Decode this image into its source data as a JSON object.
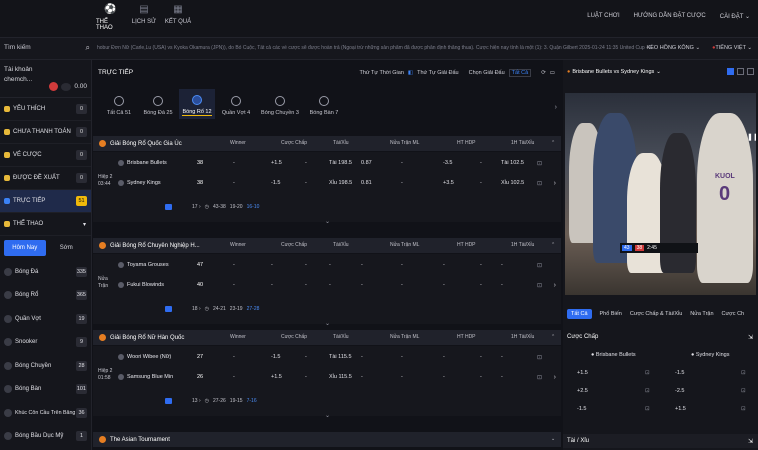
{
  "nav": {
    "items": [
      {
        "label": "THỂ THAO",
        "icon": "soccer-ball-icon"
      },
      {
        "label": "LỊCH SỬ",
        "icon": "history-icon"
      },
      {
        "label": "KẾT QUẢ",
        "icon": "results-icon"
      }
    ],
    "links": [
      "LUẬT CHƠI",
      "HƯỚNG DẪN ĐẶT CƯỢC",
      "CÀI ĐẶT"
    ]
  },
  "search": {
    "placeholder": "Tìm kiếm"
  },
  "ticker": {
    "text": "hobur Đơn Nữ (Carle,Lu (USA) vs Kyoka Okamura (JPN)), do Bỏ Cuộc, Tất cả các vé cược sẽ được hoàn trả (Ngoại trừ những sản phẩm đã được phân định thắng thua). Cược hiện nay tính là một (1): 3. Quận Gilbert 2025-01-24 11:35 United Cup - Đài Nam",
    "odds_format": "KÈO HỒNG KÔNG",
    "language": "TIẾNG VIỆT"
  },
  "account": {
    "label": "Tài khoản",
    "name": "chemch...",
    "balance": "0.00"
  },
  "sidebar": {
    "items": [
      {
        "label": "YÊU THÍCH",
        "count": "0"
      },
      {
        "label": "CHƯA THANH TOÁN",
        "count": "0"
      },
      {
        "label": "VÉ CƯỢC",
        "count": "0"
      },
      {
        "label": "ĐƯỢC ĐỀ XUẤT",
        "count": "0"
      },
      {
        "label": "TRỰC TIẾP",
        "count": "51"
      },
      {
        "label": "THỂ THAO",
        "count": ""
      }
    ],
    "segment": [
      "Hôm Nay",
      "Sớm"
    ],
    "sports": [
      {
        "label": "Bóng Đá",
        "count": "335"
      },
      {
        "label": "Bóng Rổ",
        "count": "365"
      },
      {
        "label": "Quần Vợt",
        "count": "19"
      },
      {
        "label": "Snooker",
        "count": "9"
      },
      {
        "label": "Bóng Chuyền",
        "count": "28"
      },
      {
        "label": "Bóng Bàn",
        "count": "101"
      },
      {
        "label": "Khúc Côn Cầu Trên Băng",
        "count": "36"
      },
      {
        "label": "Bóng Bầu Dục Mỹ",
        "count": "1"
      }
    ]
  },
  "main": {
    "title": "TRỰC TIẾP",
    "sort_label": "Thứ Tự Thời Gian",
    "sort_active": "Thứ Tự Giải Đấu",
    "select_label": "Chọn Giải Đấu",
    "select_value": "Tất Cả",
    "tabs": [
      {
        "label": "Tất Cả 51"
      },
      {
        "label": "Bóng Đá 25"
      },
      {
        "label": "Bóng Rổ 12"
      },
      {
        "label": "Quần Vợt 4"
      },
      {
        "label": "Bóng Chuyền 3"
      },
      {
        "label": "Bóng Bàn 7"
      }
    ],
    "columns": [
      "Winner",
      "Cược Chấp",
      "Tài/Xỉu",
      "Nửa Trận ML",
      "HT HDP",
      "1H Tài/Xỉu"
    ]
  },
  "leagues": [
    {
      "name": "Giải Bóng Rổ Quốc Gia Úc",
      "period": [
        "Hiệp 2",
        "03:44"
      ],
      "teams": [
        {
          "name": "Brisbane Bullets",
          "score": "38",
          "winner": "-",
          "hdp_line": "+1.5",
          "hdp_odds": "-",
          "ou_line": "Tài 198.5",
          "ou_odds": "0.87",
          "ht_ml": "-",
          "ht_hdp_line": "-3.5",
          "ht_hdp_odds": "-",
          "h1_ou_line": "Tài 102.5",
          "h1_ou_odds": "-"
        },
        {
          "name": "Sydney Kings",
          "score": "38",
          "winner": "-",
          "hdp_line": "-1.5",
          "hdp_odds": "-",
          "ou_line": "Xỉu 198.5",
          "ou_odds": "0.81",
          "ht_ml": "-",
          "ht_hdp_line": "+3.5",
          "ht_hdp_odds": "-",
          "h1_ou_line": "Xỉu 102.5",
          "h1_ou_odds": "-"
        }
      ],
      "footer": {
        "markets": "17",
        "q1": "43-38",
        "q2": "19-20",
        "q3": "16-10"
      }
    },
    {
      "name": "Giải Bóng Rổ Chuyên Nghiệp H...",
      "period": [
        "Nửa",
        "Trận"
      ],
      "teams": [
        {
          "name": "Toyama Grouses",
          "score": "47",
          "winner": "-",
          "hdp_line": "-",
          "hdp_odds": "-",
          "ou_line": "-",
          "ou_odds": "-",
          "ht_ml": "-",
          "ht_hdp_line": "-",
          "ht_hdp_odds": "-",
          "h1_ou_line": "-",
          "h1_ou_odds": "-"
        },
        {
          "name": "Fukui Blowinds",
          "score": "40",
          "winner": "-",
          "hdp_line": "-",
          "hdp_odds": "-",
          "ou_line": "-",
          "ou_odds": "-",
          "ht_ml": "-",
          "ht_hdp_line": "-",
          "ht_hdp_odds": "-",
          "h1_ou_line": "-",
          "h1_ou_odds": "-"
        }
      ],
      "footer": {
        "markets": "18",
        "q1": "24-21",
        "q2": "23-19",
        "q3": "27-28"
      }
    },
    {
      "name": "Giải Bóng Rổ Nữ Hàn Quốc",
      "period": [
        "Hiệp 2",
        "01:58"
      ],
      "teams": [
        {
          "name": "Woori Wibee (Nữ)",
          "score": "27",
          "winner": "-",
          "hdp_line": "-1.5",
          "hdp_odds": "-",
          "ou_line": "Tài 115.5",
          "ou_odds": "-",
          "ht_ml": "-",
          "ht_hdp_line": "-",
          "ht_hdp_odds": "-",
          "h1_ou_line": "-",
          "h1_ou_odds": "-"
        },
        {
          "name": "Samsung Blue Min",
          "score": "26",
          "winner": "-",
          "hdp_line": "+1.5",
          "hdp_odds": "-",
          "ou_line": "Xỉu 115.5",
          "ou_odds": "-",
          "ht_ml": "-",
          "ht_hdp_line": "-",
          "ht_hdp_odds": "-",
          "h1_ou_line": "-",
          "h1_ou_odds": "-"
        }
      ],
      "footer": {
        "markets": "13",
        "q1": "27-26",
        "q2": "19-15",
        "q3": "7-16"
      }
    },
    {
      "name": "The Asian Tournament"
    }
  ],
  "right_panel": {
    "match_title": "Brisbane Bullets vs Sydney Kings",
    "hud": {
      "home": "43",
      "away": "38",
      "clock": "2:45"
    },
    "jersey": {
      "name": "KUOL",
      "number": "0"
    },
    "odds_tabs": [
      "Tất Cả",
      "Phổ Biến",
      "Cược Chấp & Tài/Xỉu",
      "Nửa Trận",
      "Cược Ch"
    ],
    "section_title": "Cược Chấp",
    "teams": [
      "Brisbane Bullets",
      "Sydney Kings"
    ],
    "rows": [
      {
        "home": "+1.5",
        "away": "-1.5"
      },
      {
        "home": "+2.5",
        "away": "-2.5"
      },
      {
        "home": "-1.5",
        "away": "+1.5"
      }
    ],
    "footer_title": "Tài / Xỉu"
  }
}
